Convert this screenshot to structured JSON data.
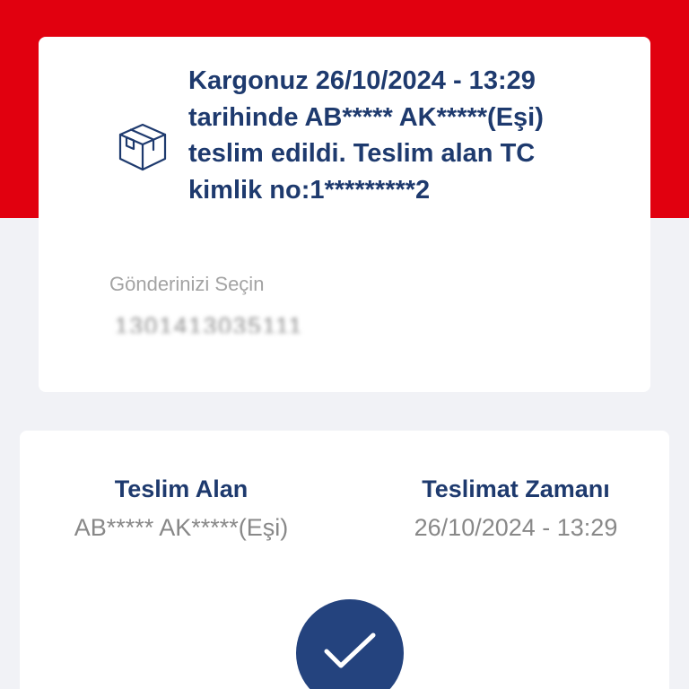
{
  "status": {
    "message": "Kargonuz 26/10/2024 - 13:29 tarihinde AB***** AK*****(Eşi) teslim edildi. Teslim alan TC kimlik no:1*********2",
    "icon": "package-box-icon"
  },
  "shipment_select": {
    "label": "Gönderinizi Seçin",
    "value": "1301413035111"
  },
  "delivery_details": {
    "receiver_title": "Teslim Alan",
    "receiver_value": "AB***** AK*****(Eşi)",
    "time_title": "Teslimat Zamanı",
    "time_value": "26/10/2024 - 13:29",
    "status_icon": "checkmark-icon"
  },
  "colors": {
    "brand_red": "#e1000f",
    "brand_navy": "#1e3a6e",
    "check_circle": "#24437e",
    "background": "#f1f2f6"
  }
}
